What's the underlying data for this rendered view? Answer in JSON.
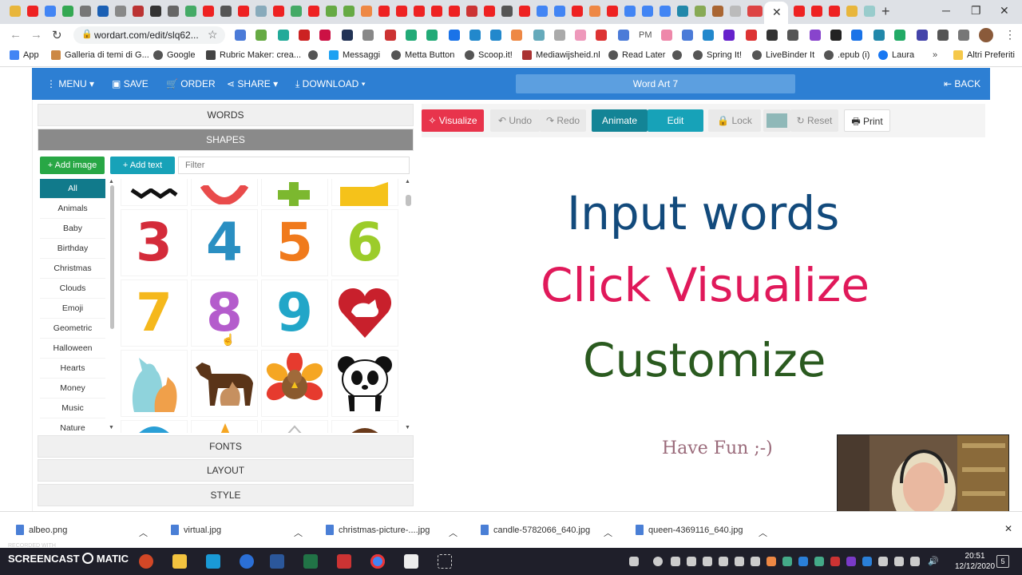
{
  "browser": {
    "url": "wordart.com/edit/slq62...",
    "bookmarks": [
      "App",
      "Galleria di temi di G...",
      "Google",
      "Rubric Maker: crea...",
      "Messaggi",
      "Metta Button",
      "Scoop.it!",
      "Mediawijsheid.nl",
      "Read Later",
      "Spring It!",
      "LiveBinder It",
      ".epub (i)",
      "Laura",
      "Altri Preferiti"
    ],
    "more_bookmarks": "»",
    "ext_pm": "PM"
  },
  "appbar": {
    "menu": "MENU",
    "save": "SAVE",
    "order": "ORDER",
    "share": "SHARE",
    "download": "DOWNLOAD",
    "title": "Word Art 7",
    "back": "BACK"
  },
  "left_panel": {
    "words_tab": "WORDS",
    "shapes_tab": "SHAPES",
    "add_image": "Add image",
    "add_text": "Add text",
    "filter_placeholder": "Filter",
    "categories": [
      "All",
      "Animals",
      "Baby",
      "Birthday",
      "Christmas",
      "Clouds",
      "Emoji",
      "Geometric",
      "Halloween",
      "Hearts",
      "Money",
      "Music",
      "Nature"
    ],
    "fonts_tab": "FONTS",
    "layout_tab": "LAYOUT",
    "style_tab": "STYLE"
  },
  "shapes": {
    "row_numbers": [
      "3",
      "4",
      "5",
      "6",
      "7",
      "8",
      "9"
    ],
    "colors": {
      "three": "#d42b3a",
      "four": "#2a8fc2",
      "five": "#f07a1c",
      "six": "#9ccc2a",
      "seven": "#f5b81c",
      "eight": "#b45ccc",
      "nine": "#22a6c8",
      "heart": "#c8202c"
    }
  },
  "workspace": {
    "visualize": "Visualize",
    "undo": "Undo",
    "redo": "Redo",
    "animate": "Animate",
    "edit": "Edit",
    "lock": "Lock",
    "reset": "Reset",
    "print": "Print",
    "lines": {
      "line1": "Input words",
      "line2": "Click Visualize",
      "line3": "Customize",
      "line4": "Have Fun ;-)"
    },
    "colors": {
      "line1": "#124a7c",
      "line2": "#e0195a",
      "line3": "#2a5a1f",
      "line4": "#9a6a7a"
    }
  },
  "downloads": [
    "albeo.png",
    "virtual.jpg",
    "christmas-picture-....jpg",
    "candle-5782066_640.jpg",
    "queen-4369116_640.jpg"
  ],
  "taskbar": {
    "watermark_top": "RECORDED WITH",
    "watermark": "SCREENCAST",
    "watermark_suffix": "MATIC",
    "time": "20:51",
    "date": "12/12/2020",
    "notifications": "5"
  }
}
